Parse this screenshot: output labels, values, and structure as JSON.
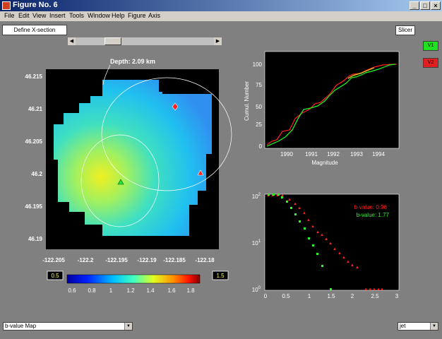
{
  "window": {
    "title": "Figure No. 6"
  },
  "menu": [
    "File",
    "Edit",
    "View",
    "Insert",
    "Tools",
    "Window",
    "Help",
    "Figure",
    "Axis"
  ],
  "buttons": {
    "define_x_section": "Define X-section",
    "slicer": "Slicer",
    "v1": "V1",
    "v2": "V2"
  },
  "map": {
    "title": "Depth: 2.09 km",
    "xticks": [
      "-122.205",
      "-122.2",
      "-122.195",
      "-122.19",
      "-122.185",
      "-122.18"
    ],
    "yticks": [
      "46.215",
      "46.21",
      "46.205",
      "46.2",
      "46.195",
      "46.19"
    ]
  },
  "colorbar": {
    "min_box": "0.5",
    "max_box": "1.5",
    "ticks": [
      "0.6",
      "0.8",
      "1",
      "1.2",
      "1.4",
      "1.6",
      "1.8"
    ]
  },
  "cumul_plot": {
    "ylabel": "Cumul. Number",
    "xlabel": "Magnitude",
    "xticks": [
      "1990",
      "1991",
      "1992",
      "1993",
      "1994"
    ],
    "yticks": [
      "0",
      "25",
      "50",
      "75",
      "100"
    ]
  },
  "fmd_plot": {
    "legend1": "b-value: 0.96",
    "legend2": "b-value: 1.77",
    "xticks": [
      "0",
      "0.5",
      "1",
      "1.5",
      "2",
      "2.5",
      "3"
    ],
    "ytick_base": "10",
    "yexp": [
      "2",
      "1",
      "0"
    ],
    "color1": "#ff2020",
    "color2": "#20ff20"
  },
  "bottom": {
    "map_type": "b-value Map",
    "colormap": "jet"
  }
}
